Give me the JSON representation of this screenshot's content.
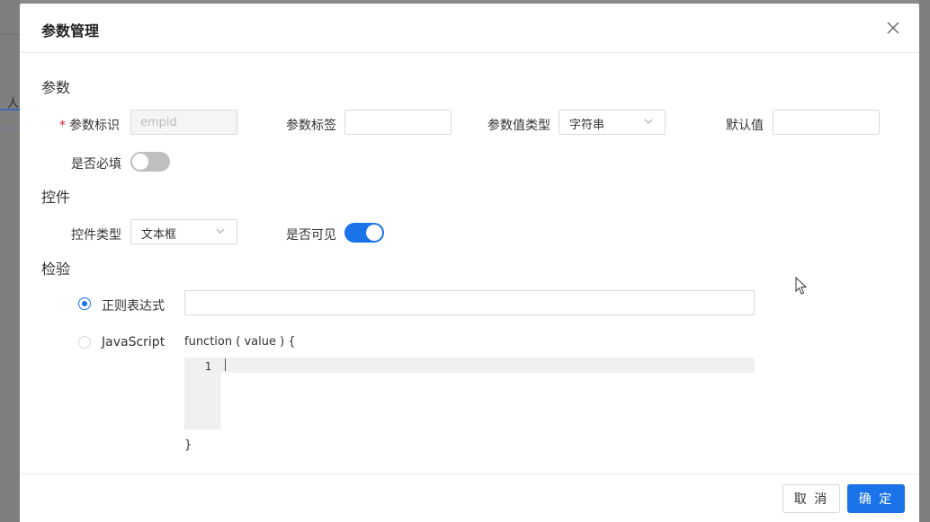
{
  "background": {
    "tab_fragment": "人"
  },
  "dialog": {
    "title": "参数管理",
    "close_icon": "close-icon"
  },
  "sections": {
    "params": "参数",
    "control": "控件",
    "validation": "检验"
  },
  "params": {
    "id_label": "参数标识",
    "id_required_mark": "*",
    "id_value": "empid",
    "tag_label": "参数标签",
    "tag_value": "",
    "type_label": "参数值类型",
    "type_value": "字符串",
    "default_label": "默认值",
    "default_value": "",
    "required_label": "是否必填",
    "required_on": false
  },
  "control": {
    "type_label": "控件类型",
    "type_value": "文本框",
    "visible_label": "是否可见",
    "visible_on": true
  },
  "validation": {
    "regex_label": "正则表达式",
    "regex_value": "",
    "regex_selected": true,
    "js_label": "JavaScript",
    "js_selected": false,
    "fn_open": "function ( value ) {",
    "fn_close": "}",
    "line_number": "1"
  },
  "footer": {
    "cancel": "取 消",
    "confirm": "确 定"
  },
  "colors": {
    "primary": "#1a73e8",
    "required": "#f5222d",
    "switch_off": "#bfbfbf"
  }
}
